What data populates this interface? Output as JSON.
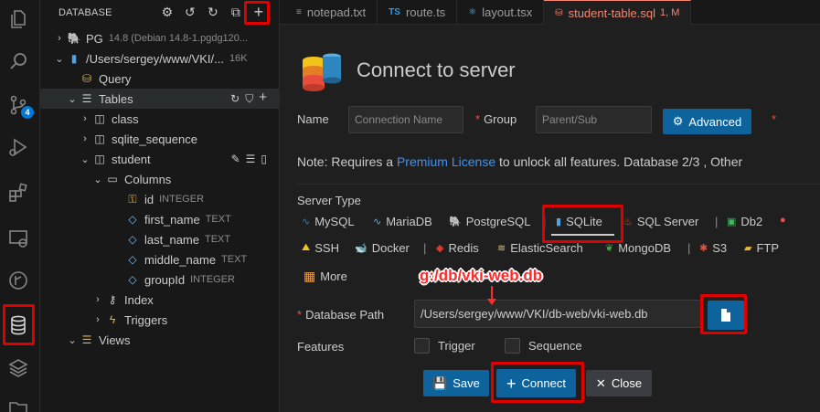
{
  "sidebar": {
    "title": "DATABASE",
    "tree": [
      {
        "label": "PG",
        "desc": "14.8 (Debian 14.8-1.pgdg120..."
      },
      {
        "label": "/Users/sergey/www/VKI/...",
        "desc": "16K"
      },
      {
        "label": "Query",
        "desc": ""
      },
      {
        "label": "Tables",
        "desc": ""
      },
      {
        "label": "class",
        "desc": ""
      },
      {
        "label": "sqlite_sequence",
        "desc": ""
      },
      {
        "label": "student",
        "desc": ""
      },
      {
        "label": "Columns",
        "desc": ""
      },
      {
        "label": "id",
        "desc": "INTEGER"
      },
      {
        "label": "first_name",
        "desc": "TEXT"
      },
      {
        "label": "last_name",
        "desc": "TEXT"
      },
      {
        "label": "middle_name",
        "desc": "TEXT"
      },
      {
        "label": "groupId",
        "desc": "INTEGER"
      },
      {
        "label": "Index",
        "desc": ""
      },
      {
        "label": "Triggers",
        "desc": ""
      },
      {
        "label": "Views",
        "desc": ""
      }
    ]
  },
  "activity": {
    "source_control_badge": "4"
  },
  "tabs": [
    {
      "label": "notepad.txt",
      "icon": "",
      "modified": ""
    },
    {
      "label": "route.ts",
      "icon": "TS",
      "modified": ""
    },
    {
      "label": "layout.tsx",
      "icon": "",
      "modified": ""
    },
    {
      "label": "student-table.sql",
      "icon": "",
      "modified": "1, M"
    }
  ],
  "connect": {
    "title": "Connect to server",
    "name_label": "Name",
    "name_placeholder": "Connection Name",
    "group_label": "Group",
    "group_placeholder": "Parent/Sub",
    "advanced_label": "Advanced",
    "note_prefix": "Note: Requires a ",
    "note_link": "Premium License",
    "note_suffix": " to unlock all features. Database 2/3 , Other",
    "server_type_label": "Server Type",
    "server_types_row1": [
      "MySQL",
      "MariaDB",
      "PostgreSQL",
      "SQLite",
      "SQL Server",
      "Db2"
    ],
    "server_types_row2": [
      "SSH",
      "Docker",
      "Redis",
      "ElasticSearch",
      "MongoDB",
      "S3",
      "FTP"
    ],
    "more_label": "More",
    "db_path_label": "Database Path",
    "db_path_value": "/Users/sergey/www/VKI/db-web/vki-web.db",
    "features_label": "Features",
    "trigger_label": "Trigger",
    "sequence_label": "Sequence",
    "save_label": "Save",
    "connect_label": "Connect",
    "close_label": "Close",
    "selected_type": "SQLite"
  },
  "annotation": {
    "text": "g:/db/vki-web.db",
    "color": "#ff2b2b"
  },
  "colors": {
    "accent": "#0e639c",
    "link": "#3794ff",
    "active_tab": "#f48771",
    "highlight": "#e00000"
  }
}
